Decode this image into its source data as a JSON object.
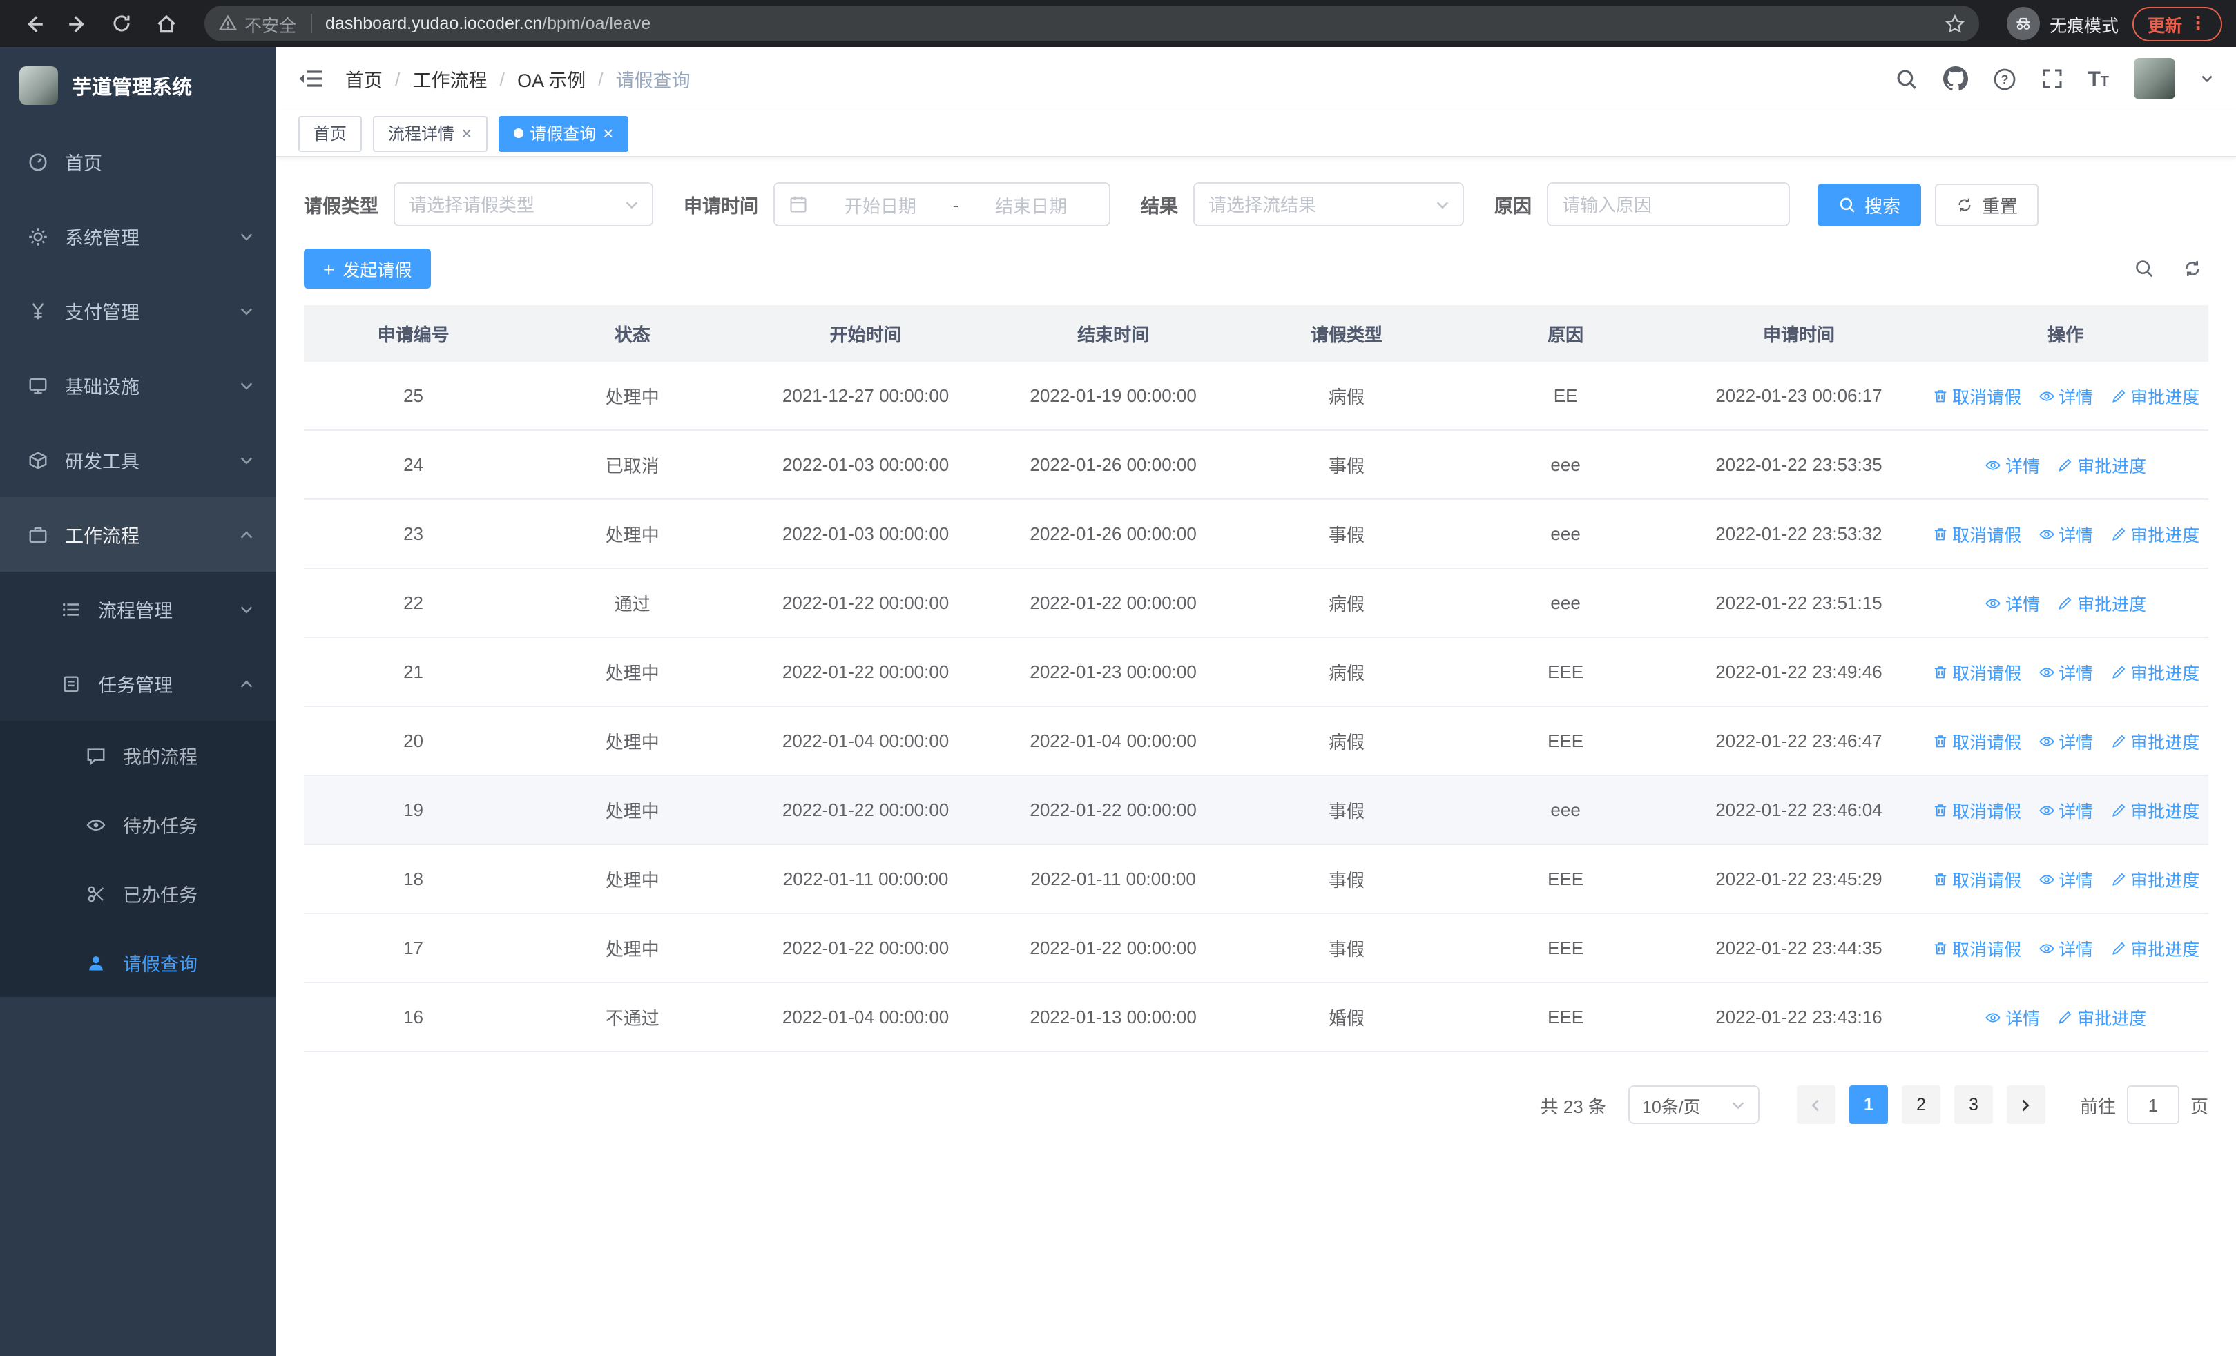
{
  "browser": {
    "security_label": "不安全",
    "url_domain": "dashboard.yudao.iocoder.cn",
    "url_path": "/bpm/oa/leave",
    "incognito_label": "无痕模式",
    "update_label": "更新"
  },
  "sidebar": {
    "logo_title": "芋道管理系统",
    "items": [
      {
        "label": "首页",
        "icon": "dashboard-icon"
      },
      {
        "label": "系统管理",
        "icon": "system-icon"
      },
      {
        "label": "支付管理",
        "icon": "payment-icon"
      },
      {
        "label": "基础设施",
        "icon": "infrastructure-icon"
      },
      {
        "label": "研发工具",
        "icon": "devtools-icon"
      },
      {
        "label": "工作流程",
        "icon": "workflow-icon"
      },
      {
        "label": "流程管理",
        "icon": "process-management-icon"
      },
      {
        "label": "任务管理",
        "icon": "task-management-icon"
      },
      {
        "label": "我的流程",
        "icon": "my-process-icon"
      },
      {
        "label": "待办任务",
        "icon": "todo-tasks-icon"
      },
      {
        "label": "已办任务",
        "icon": "done-tasks-icon"
      },
      {
        "label": "请假查询",
        "icon": "leave-query-icon"
      }
    ]
  },
  "header": {
    "breadcrumb": [
      "首页",
      "工作流程",
      "OA 示例",
      "请假查询"
    ]
  },
  "tabs": [
    {
      "label": "首页"
    },
    {
      "label": "流程详情"
    },
    {
      "label": "请假查询"
    }
  ],
  "filters": {
    "leave_type_label": "请假类型",
    "leave_type_placeholder": "请选择请假类型",
    "apply_time_label": "申请时间",
    "start_date_placeholder": "开始日期",
    "range_separator": "-",
    "end_date_placeholder": "结束日期",
    "result_label": "结果",
    "result_placeholder": "请选择流结果",
    "reason_label": "原因",
    "reason_placeholder": "请输入原因",
    "search_button": "搜索",
    "reset_button": "重置"
  },
  "toolbar": {
    "create_button": "发起请假"
  },
  "table": {
    "columns": [
      "申请编号",
      "状态",
      "开始时间",
      "结束时间",
      "请假类型",
      "原因",
      "申请时间",
      "操作"
    ],
    "actions": {
      "cancel": "取消请假",
      "detail": "详情",
      "progress": "审批进度"
    },
    "rows": [
      {
        "id": "25",
        "status": "处理中",
        "start": "2021-12-27 00:00:00",
        "end": "2022-01-19 00:00:00",
        "type": "病假",
        "reason": "EE",
        "apply_time": "2022-01-23 00:06:17",
        "can_cancel": true,
        "highlight": false
      },
      {
        "id": "24",
        "status": "已取消",
        "start": "2022-01-03 00:00:00",
        "end": "2022-01-26 00:00:00",
        "type": "事假",
        "reason": "eee",
        "apply_time": "2022-01-22 23:53:35",
        "can_cancel": false,
        "highlight": false
      },
      {
        "id": "23",
        "status": "处理中",
        "start": "2022-01-03 00:00:00",
        "end": "2022-01-26 00:00:00",
        "type": "事假",
        "reason": "eee",
        "apply_time": "2022-01-22 23:53:32",
        "can_cancel": true,
        "highlight": false
      },
      {
        "id": "22",
        "status": "通过",
        "start": "2022-01-22 00:00:00",
        "end": "2022-01-22 00:00:00",
        "type": "病假",
        "reason": "eee",
        "apply_time": "2022-01-22 23:51:15",
        "can_cancel": false,
        "highlight": false
      },
      {
        "id": "21",
        "status": "处理中",
        "start": "2022-01-22 00:00:00",
        "end": "2022-01-23 00:00:00",
        "type": "病假",
        "reason": "EEE",
        "apply_time": "2022-01-22 23:49:46",
        "can_cancel": true,
        "highlight": false
      },
      {
        "id": "20",
        "status": "处理中",
        "start": "2022-01-04 00:00:00",
        "end": "2022-01-04 00:00:00",
        "type": "病假",
        "reason": "EEE",
        "apply_time": "2022-01-22 23:46:47",
        "can_cancel": true,
        "highlight": false
      },
      {
        "id": "19",
        "status": "处理中",
        "start": "2022-01-22 00:00:00",
        "end": "2022-01-22 00:00:00",
        "type": "事假",
        "reason": "eee",
        "apply_time": "2022-01-22 23:46:04",
        "can_cancel": true,
        "highlight": true
      },
      {
        "id": "18",
        "status": "处理中",
        "start": "2022-01-11 00:00:00",
        "end": "2022-01-11 00:00:00",
        "type": "事假",
        "reason": "EEE",
        "apply_time": "2022-01-22 23:45:29",
        "can_cancel": true,
        "highlight": false
      },
      {
        "id": "17",
        "status": "处理中",
        "start": "2022-01-22 00:00:00",
        "end": "2022-01-22 00:00:00",
        "type": "事假",
        "reason": "EEE",
        "apply_time": "2022-01-22 23:44:35",
        "can_cancel": true,
        "highlight": false
      },
      {
        "id": "16",
        "status": "不通过",
        "start": "2022-01-04 00:00:00",
        "end": "2022-01-13 00:00:00",
        "type": "婚假",
        "reason": "EEE",
        "apply_time": "2022-01-22 23:43:16",
        "can_cancel": false,
        "highlight": false
      }
    ]
  },
  "pagination": {
    "total_text": "共 23 条",
    "page_size": "10条/页",
    "pages": [
      "1",
      "2",
      "3"
    ],
    "active_page": "1",
    "goto_label": "前往",
    "goto_value": "1",
    "goto_suffix": "页"
  }
}
